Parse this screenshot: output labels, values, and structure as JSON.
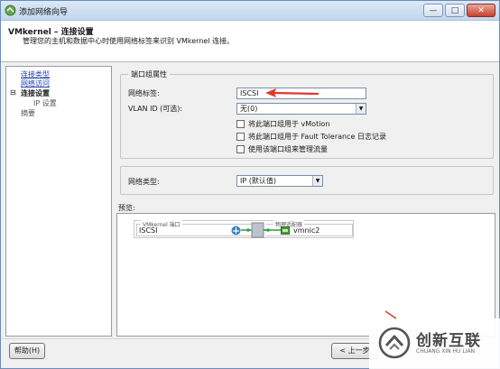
{
  "window": {
    "title": "添加网络向导",
    "controls": {
      "minimize": "—",
      "maximize": "□",
      "close": "✕"
    }
  },
  "header": {
    "title": "VMkernel – 连接设置",
    "description": "管理您的主机和数据中心时使用网络标签来识别 VMkernel 连接。"
  },
  "nav": {
    "items": [
      {
        "label": "连接类型",
        "state": "link"
      },
      {
        "label": "网络访问",
        "state": "link"
      },
      {
        "label": "连接设置",
        "state": "current",
        "marker": "⊟"
      },
      {
        "label": "IP 设置",
        "state": "sub"
      },
      {
        "label": "摘要",
        "state": "plain"
      }
    ]
  },
  "port_group": {
    "legend": "端口组属性",
    "network_label_label": "网络标签:",
    "network_label_value": "ISCSI",
    "vlan_label": "VLAN ID (可选):",
    "vlan_value": "无(0)",
    "checkboxes": [
      {
        "label": "将此端口组用于 vMotion",
        "checked": false
      },
      {
        "label": "将此端口组用于 Fault Tolerance 日志记录",
        "checked": false
      },
      {
        "label": "使用该端口组来管理流量",
        "checked": false
      }
    ]
  },
  "network_type": {
    "label": "网络类型:",
    "value": "IP (默认值)"
  },
  "preview": {
    "label": "预览:",
    "vmkernel_legend": "VMkernel 端口",
    "vmkernel_port": "ISCSI",
    "adapter_legend": "物理适配器",
    "adapter": "vmnic2"
  },
  "footer": {
    "help_button": "帮助(H)",
    "back_button": "< 上一步"
  },
  "watermark": {
    "chinese": "创新互联",
    "english": "CHUANG XIN HU LIAN"
  },
  "colors": {
    "annotation_arrow": "#e0392b",
    "link": "#2244aa",
    "connector": "#2e9e3e"
  }
}
